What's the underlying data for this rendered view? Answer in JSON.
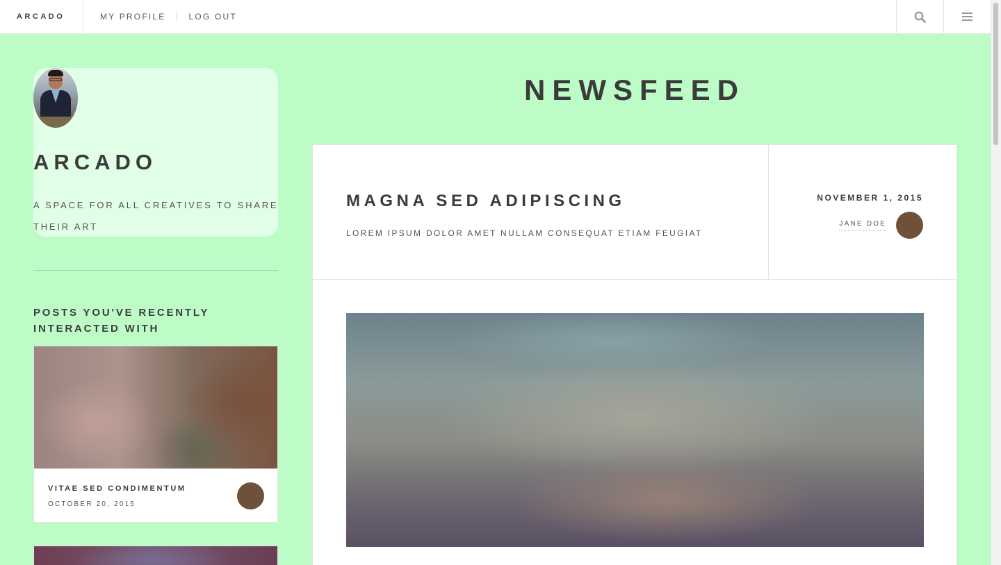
{
  "nav": {
    "brand": "ARCADO",
    "links": [
      "MY PROFILE",
      "LOG OUT"
    ],
    "icons": [
      "search-icon",
      "menu-icon"
    ]
  },
  "sidebar": {
    "title": "ARCADO",
    "tagline": "A SPACE FOR ALL CREATIVES TO SHARE THEIR ART",
    "recent_heading": "POSTS YOU'VE RECENTLY INTERACTED WITH",
    "recent_posts": [
      {
        "title": "VITAE SED CONDIMENTUM",
        "date": "OCTOBER 20, 2015"
      }
    ]
  },
  "main": {
    "title": "NEWSFEED",
    "post": {
      "title": "MAGNA SED ADIPISCING",
      "subtitle": "LOREM IPSUM DOLOR AMET NULLAM CONSEQUAT ETIAM FEUGIAT",
      "date": "NOVEMBER 1, 2015",
      "author": "JANE DOE"
    }
  },
  "colors": {
    "background": "#bdfcc7",
    "text": "#3c3b3b",
    "avatar": "#6f5039"
  }
}
